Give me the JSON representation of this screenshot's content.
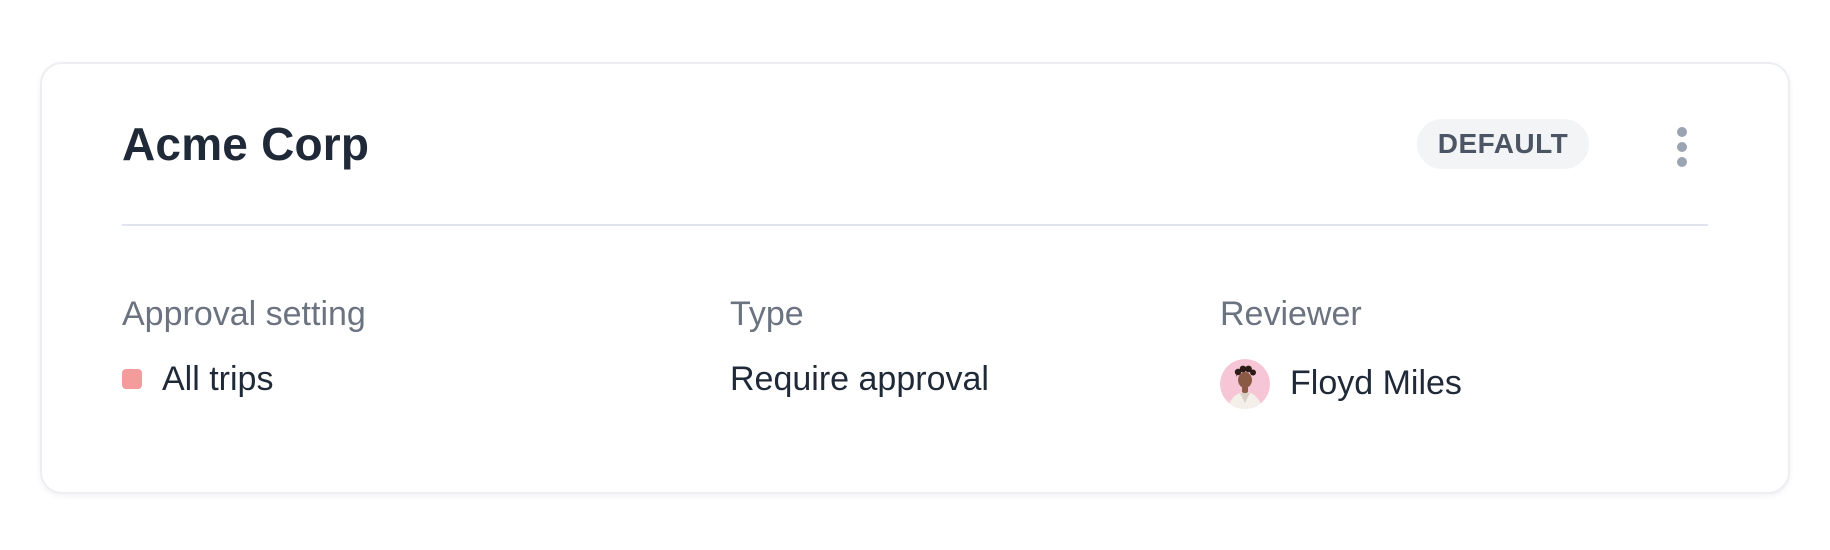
{
  "card": {
    "title": "Acme Corp",
    "badge": "DEFAULT",
    "menu_icon": "kebab-vertical-icon"
  },
  "columns": {
    "approval_setting": {
      "label": "Approval setting",
      "value": "All trips",
      "swatch_color": "#f49b9b"
    },
    "type": {
      "label": "Type",
      "value": "Require approval"
    },
    "reviewer": {
      "label": "Reviewer",
      "name": "Floyd Miles",
      "avatar_icon": "user-avatar"
    }
  },
  "colors": {
    "title": "#1f2937",
    "label": "#6b7280",
    "badge_bg": "#f3f4f6",
    "badge_text": "#4b5563",
    "divider": "#dfe5ef",
    "avatar_bg": "#f7c6d6"
  }
}
